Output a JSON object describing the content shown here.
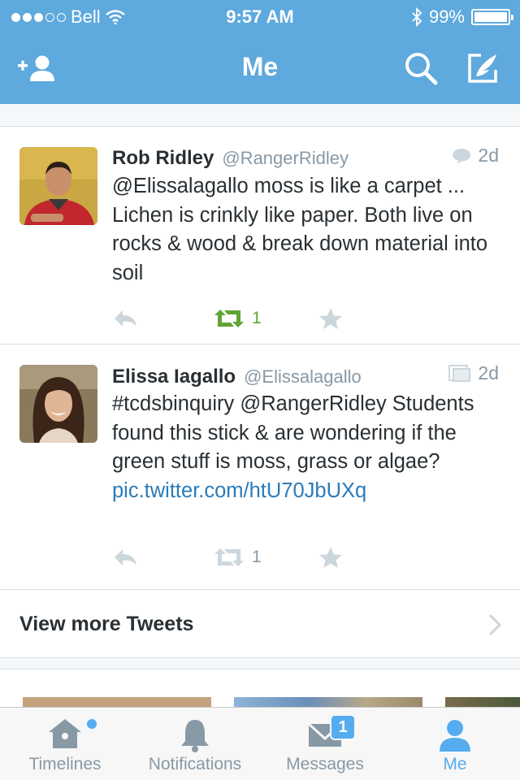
{
  "status_bar": {
    "carrier": "Bell",
    "time": "9:57 AM",
    "battery": "99%",
    "battery_level": 0.99
  },
  "nav": {
    "title": "Me",
    "left_icon": "add-user-icon",
    "right_icons": [
      "search-icon",
      "compose-icon"
    ]
  },
  "tweets": [
    {
      "name": "Rob Ridley",
      "handle": "@RangerRidley",
      "meta_icon": "conversation-icon",
      "time": "2d",
      "text": "@Elissalagallo moss is like a carpet ... Lichen is crinkly like paper. Both live on rocks & wood & break down material into soil",
      "retweet_count": "1",
      "retweeted": true
    },
    {
      "name": "Elissa Iagallo",
      "handle": "@Elissalagallo",
      "meta_icon": "photo-icon",
      "time": "2d",
      "text": "#tcdsbinquiry @RangerRidley Students found this stick & are wondering if the green stuff is moss, grass or algae?",
      "link": "pic.twitter.com/htU70JbUXq",
      "retweet_count": "1",
      "retweeted": false
    }
  ],
  "view_more": "View more Tweets",
  "tabs": [
    {
      "label": "Timelines",
      "icon": "home-icon"
    },
    {
      "label": "Notifications",
      "icon": "bell-icon"
    },
    {
      "label": "Messages",
      "icon": "messages-icon",
      "badge": "1"
    },
    {
      "label": "Me",
      "icon": "person-icon",
      "active": true
    }
  ],
  "colors": {
    "brand": "#5ea9dd",
    "accent": "#55acee",
    "link": "#2b7bb9",
    "retweet_active": "#5fa533",
    "muted": "#8899a6"
  }
}
